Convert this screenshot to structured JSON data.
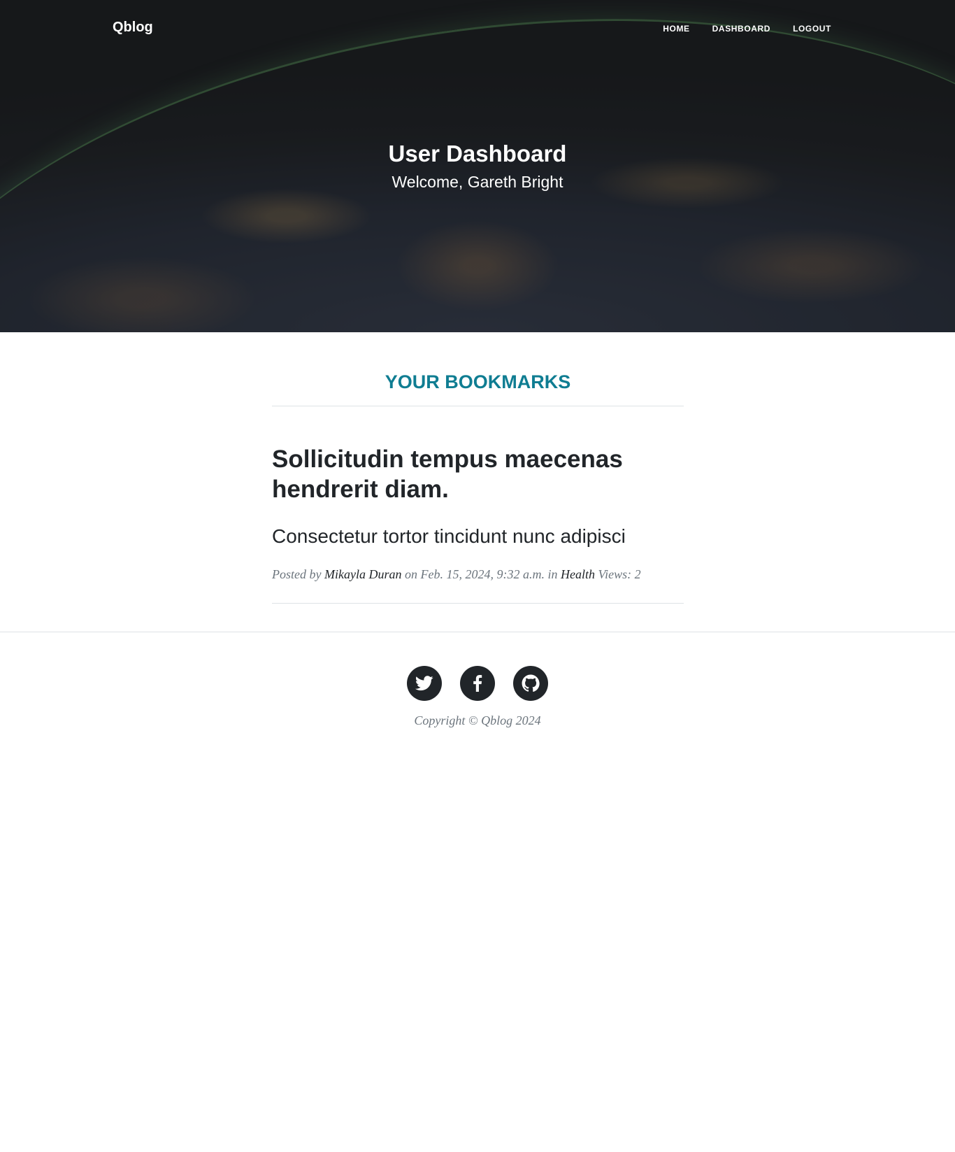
{
  "nav": {
    "brand": "Qblog",
    "links": [
      "Home",
      "Dashboard",
      "Logout"
    ]
  },
  "hero": {
    "title": "User Dashboard",
    "subtitle": "Welcome, Gareth Bright"
  },
  "bookmarks": {
    "heading": "YOUR BOOKMARKS",
    "posts": [
      {
        "title": "Sollicitudin tempus maecenas hendrerit diam.",
        "subtitle": "Consectetur tortor tincidunt nunc adipisci",
        "meta_posted_by": "Posted by",
        "author": "Mikayla Duran",
        "meta_on": "on Feb. 15, 2024, 9:32 a.m. in",
        "category": "Health",
        "views": "Views: 2"
      }
    ]
  },
  "footer": {
    "social": [
      "twitter-icon",
      "facebook-icon",
      "github-icon"
    ],
    "copyright": "Copyright © Qblog 2024"
  },
  "colors": {
    "accent": "#0f7d92",
    "text": "#212529",
    "muted": "#6c757d"
  }
}
